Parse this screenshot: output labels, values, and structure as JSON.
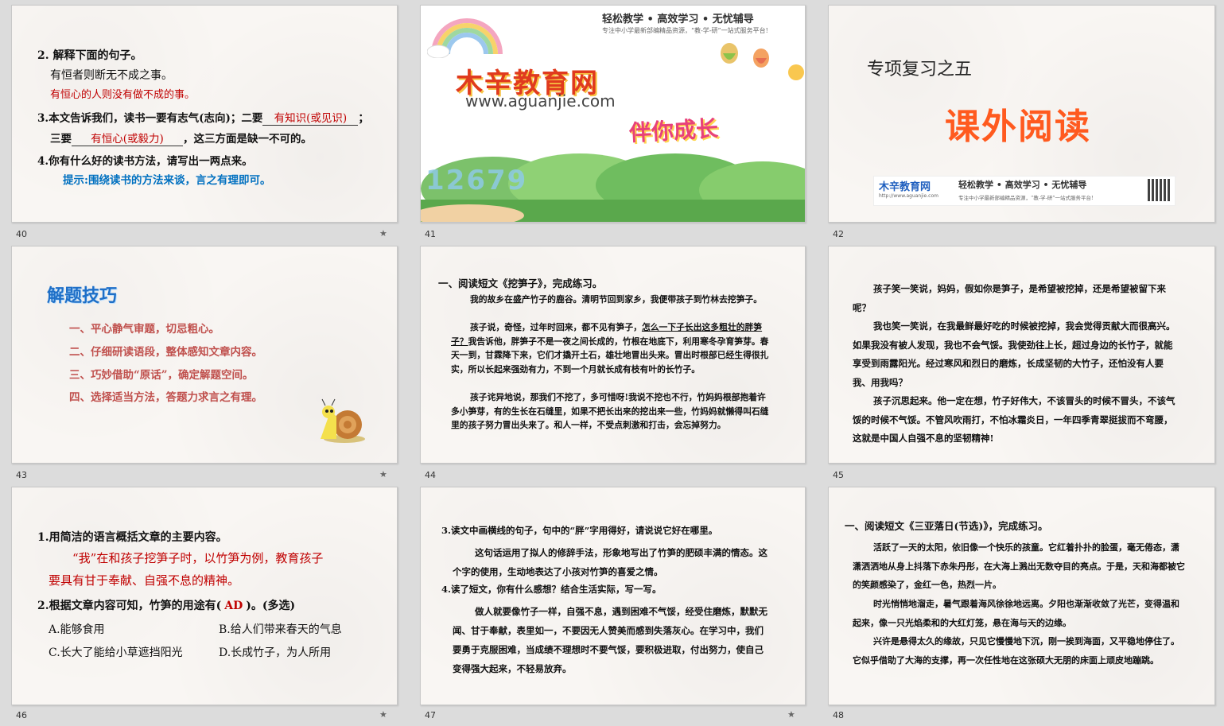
{
  "slides": {
    "s40": {
      "num": "40",
      "q2": "2. 解释下面的句子。",
      "sent": "有恒者则断无不成之事。",
      "ans": "有恒心的人则没有做不成的事。",
      "q3a": "3.本文告诉我们，读书一要有志气(志向)；二要",
      "q3b": "有知识(或见识)",
      "q3c": "；",
      "q3d": "三要",
      "q3e": "有恒心(或毅力)",
      "q3f": "，这三方面是缺一不可的。",
      "q4": "4.你有什么好的读书方法，请写出一两点来。",
      "hint": "提示:围绕读书的方法来谈，言之有理即可。"
    },
    "s41": {
      "num": "41",
      "top1": "轻松教学 • 高效学习 • 无忧辅导",
      "top2": "专注中小学最新部编精品资源，“教-学-研”一站式服务平台!",
      "brand": "木辛教育网",
      "url": "www.aguanjie.com",
      "slogan": "伴你成长",
      "digits": "12679"
    },
    "s42": {
      "num": "42",
      "sub": "专项复习之五",
      "title": "课外阅读",
      "brand": "木辛教育网",
      "burl": "http://www.aguanjie.com",
      "bl1": "轻松教学 • 高效学习 • 无忧辅导",
      "bl2": "专注中小学最新部编精品资源，“教-学-研”一站式服务平台!"
    },
    "s43": {
      "num": "43",
      "title": "解题技巧",
      "tips": [
        "一、平心静气审题，切忌粗心。",
        "二、仔细研读语段，整体感知文章内容。",
        "三、巧妙借助“原话”，确定解题空间。",
        "四、选择适当方法，答题力求言之有理。"
      ]
    },
    "s44": {
      "num": "44",
      "head": "一、阅读短文《挖笋子》，完成练习。",
      "p1": "我的故乡在盛产竹子的鹿谷。清明节回到家乡，我便带孩子到竹林去挖笋子。",
      "p2a": "孩子说，奇怪，过年时回来，都不见有笋子，",
      "p2b": "怎么一下子长出这多粗壮的胖笋子？",
      "p2c": "我告诉他，胖笋子不是一夜之间长成的，竹根在地底下，利用寒冬孕育笋芽。春天一到，甘霖降下来，它们才撬开土石，雄壮地冒出头来。冒出时根部已经生得很扎实，所以长起来强劲有力，不到一个月就长成有枝有叶的长竹子。",
      "p3": "孩子诧异地说，那我们不挖了，多可惜呀!我说不挖也不行，竹妈妈根部抱着许多小笋芽，有的生长在石缝里，如果不把长出来的挖出来一些，竹妈妈就懒得叫石缝里的孩子努力冒出头来了。和人一样，不受点刺激和打击，会忘掉努力。"
    },
    "s45": {
      "num": "45",
      "p1": "孩子笑一笑说，妈妈，假如你是笋子，是希望被挖掉，还是希望被留下来呢？",
      "p2": "我也笑一笑说，在我最鲜最好吃的时候被挖掉，我会觉得贡献大而很高兴。如果我没有被人发现，我也不会气馁。我使劲往上长，超过身边的长竹子，就能享受到雨露阳光。经过寒风和烈日的磨炼，长成坚韧的大竹子，还怕没有人要我、用我吗？",
      "p3": "孩子沉思起来。他一定在想，竹子好伟大，不该冒头的时候不冒头，不该气馁的时候不气馁。不管风吹雨打，不怕冰霜炎日，一年四季青翠挺拔而不弯腰，这就是中国人自强不息的坚韧精神!"
    },
    "s46": {
      "num": "46",
      "q1": "1.用简洁的语言概括文章的主要内容。",
      "a1a": "“我”在和孩子挖笋子时，以竹笋为例，教育孩子",
      "a1b": "要具有甘于奉献、自强不息的精神。",
      "q2a": "2.根据文章内容可知，竹笋的用途有(",
      "q2ans": "AD",
      "q2b": ")。(多选)",
      "optA": "A.能够食用",
      "optB": "B.给人们带来春天的气息",
      "optC": "C.长大了能给小草遮挡阳光",
      "optD": "D.长成竹子，为人所用"
    },
    "s47": {
      "num": "47",
      "q3": "3.读文中画横线的句子，句中的“胖”字用得好，请说说它好在哪里。",
      "a3": "这句话运用了拟人的修辞手法，形象地写出了竹笋的肥硕丰满的情态。这个字的使用，生动地表达了小孩对竹笋的喜爱之情。",
      "q4": "4.读了短文，你有什么感想？结合生活实际，写一写。",
      "a4": "做人就要像竹子一样，自强不息，遇到困难不气馁，经受住磨炼，默默无闻、甘于奉献，表里如一，不要因无人赞美而感到失落灰心。在学习中，我们要勇于克服困难，当成绩不理想时不要气馁，要积极进取，付出努力，使自己变得强大起来，不轻易放弃。"
    },
    "s48": {
      "num": "48",
      "head": "一、阅读短文《三亚落日(节选)》，完成练习。",
      "p1": "活跃了一天的太阳，依旧像一个快乐的孩童。它红着扑扑的脸蛋，毫无倦态，潇潇洒洒地从身上抖落下赤朱丹彤，在大海上溅出无数夺目的亮点。于是，天和海都被它的笑颜感染了，金红一色，热烈一片。",
      "p2": "时光悄悄地溜走，暑气跟着海风徐徐地远离。夕阳也渐渐收敛了光芒，变得温和起来，像一只光焰柔和的大红灯笼，悬在海与天的边缘。",
      "p3": "兴许是悬得太久的缘故，只见它慢慢地下沉，刚一挨到海面，又平稳地停住了。它似乎借助了大海的支撑，再一次任性地在这张硕大无朋的床面上顽皮地蹦跳。"
    }
  },
  "colors": {
    "red": "#c00000",
    "blue": "#0070c0",
    "brown": "#c0504d",
    "orange": "#ff5a1f"
  }
}
